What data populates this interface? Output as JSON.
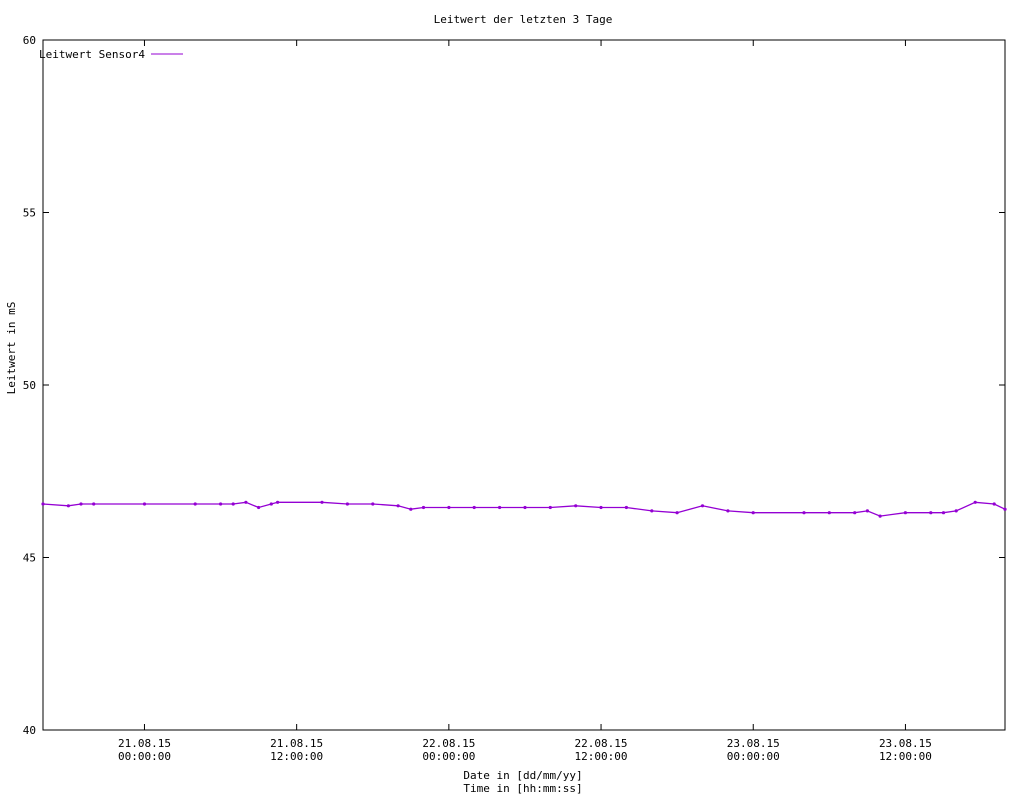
{
  "chart_data": {
    "type": "line",
    "title": "Leitwert der letzten 3 Tage",
    "ylabel": "Leitwert in mS",
    "xlabel_lines": [
      "Date in [dd/mm/yy]",
      "Time in [hh:mm:ss]"
    ],
    "ylim": [
      40,
      60
    ],
    "yticks": [
      40,
      45,
      50,
      55,
      60
    ],
    "xlim": [
      "2015-08-20T16:00:00",
      "2015-08-23T19:51:00"
    ],
    "xticks": [
      {
        "x": "2015-08-21T00:00:00",
        "date": "21.08.15",
        "time": "00:00:00"
      },
      {
        "x": "2015-08-21T12:00:00",
        "date": "21.08.15",
        "time": "12:00:00"
      },
      {
        "x": "2015-08-22T00:00:00",
        "date": "22.08.15",
        "time": "00:00:00"
      },
      {
        "x": "2015-08-22T12:00:00",
        "date": "22.08.15",
        "time": "12:00:00"
      },
      {
        "x": "2015-08-23T00:00:00",
        "date": "23.08.15",
        "time": "00:00:00"
      },
      {
        "x": "2015-08-23T12:00:00",
        "date": "23.08.15",
        "time": "12:00:00"
      }
    ],
    "legend_position": "top-left",
    "grid": false,
    "series": [
      {
        "name": "Leitwert Sensor4",
        "color": "#9400d3",
        "x": [
          "2015-08-20T16:00:00",
          "2015-08-20T18:00:00",
          "2015-08-20T19:00:00",
          "2015-08-20T20:00:00",
          "2015-08-21T00:00:00",
          "2015-08-21T04:00:00",
          "2015-08-21T06:00:00",
          "2015-08-21T07:00:00",
          "2015-08-21T08:00:00",
          "2015-08-21T09:00:00",
          "2015-08-21T10:00:00",
          "2015-08-21T10:30:00",
          "2015-08-21T14:00:00",
          "2015-08-21T16:00:00",
          "2015-08-21T18:00:00",
          "2015-08-21T20:00:00",
          "2015-08-21T21:00:00",
          "2015-08-21T22:00:00",
          "2015-08-22T00:00:00",
          "2015-08-22T02:00:00",
          "2015-08-22T04:00:00",
          "2015-08-22T06:00:00",
          "2015-08-22T08:00:00",
          "2015-08-22T10:00:00",
          "2015-08-22T12:00:00",
          "2015-08-22T14:00:00",
          "2015-08-22T16:00:00",
          "2015-08-22T18:00:00",
          "2015-08-22T20:00:00",
          "2015-08-22T22:00:00",
          "2015-08-23T00:00:00",
          "2015-08-23T04:00:00",
          "2015-08-23T06:00:00",
          "2015-08-23T08:00:00",
          "2015-08-23T09:00:00",
          "2015-08-23T10:00:00",
          "2015-08-23T12:00:00",
          "2015-08-23T14:00:00",
          "2015-08-23T15:00:00",
          "2015-08-23T16:00:00",
          "2015-08-23T17:30:00",
          "2015-08-23T19:00:00",
          "2015-08-23T19:51:00"
        ],
        "y": [
          46.55,
          46.5,
          46.55,
          46.55,
          46.55,
          46.55,
          46.55,
          46.55,
          46.6,
          46.45,
          46.55,
          46.6,
          46.6,
          46.55,
          46.55,
          46.5,
          46.4,
          46.45,
          46.45,
          46.45,
          46.45,
          46.45,
          46.45,
          46.5,
          46.45,
          46.45,
          46.35,
          46.3,
          46.5,
          46.35,
          46.3,
          46.3,
          46.3,
          46.3,
          46.35,
          46.2,
          46.3,
          46.3,
          46.3,
          46.35,
          46.6,
          46.55,
          46.4
        ]
      }
    ]
  }
}
